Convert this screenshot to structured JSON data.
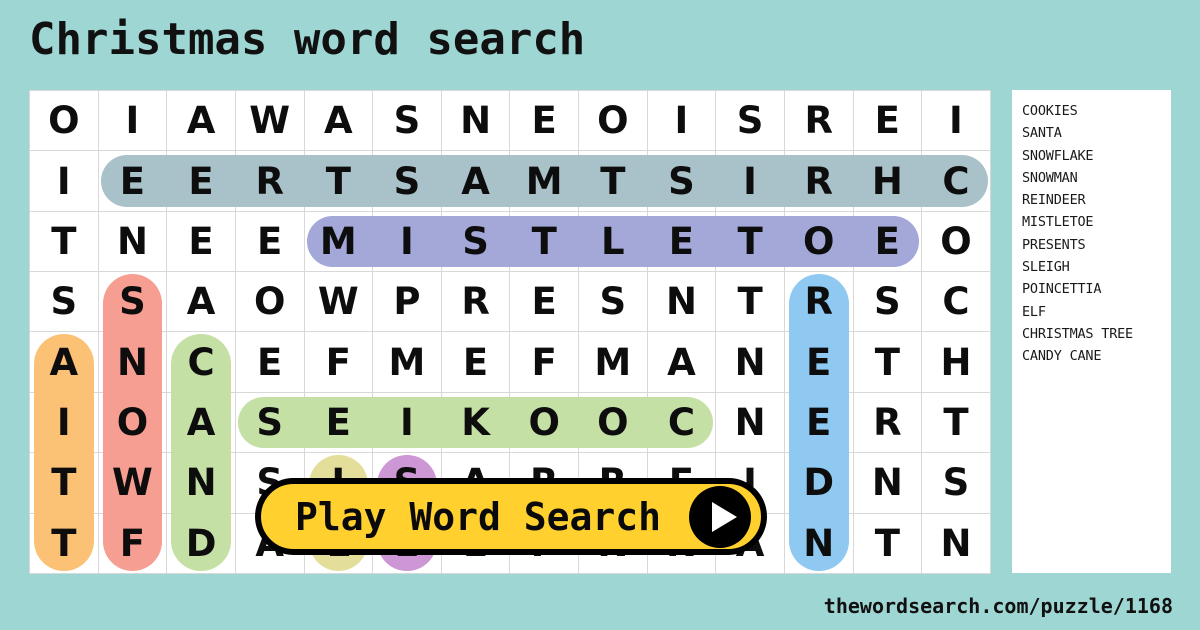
{
  "page": {
    "title": "Christmas word search",
    "background_color": "#9ed6d3",
    "footer_url": "thewordsearch.com/puzzle/1168"
  },
  "play_button": {
    "label": "Play Word Search",
    "icon": "play-triangle-icon",
    "background_color": "#ffd02e",
    "border_color": "#000000"
  },
  "word_list": {
    "words": [
      "COOKIES",
      "SANTA",
      "SNOWFLAKE",
      "SNOWMAN",
      "REINDEER",
      "MISTLETOE",
      "PRESENTS",
      "SLEIGH",
      "POINCETTIA",
      "ELF",
      "CHRISTMAS TREE",
      "CANDY CANE"
    ]
  },
  "grid": {
    "rows": 8,
    "cols": 14,
    "letters": [
      [
        "O",
        "I",
        "A",
        "W",
        "A",
        "S",
        "N",
        "E",
        "O",
        "I",
        "S",
        "R",
        "E",
        "I"
      ],
      [
        "I",
        "E",
        "E",
        "R",
        "T",
        "S",
        "A",
        "M",
        "T",
        "S",
        "I",
        "R",
        "H",
        "C"
      ],
      [
        "T",
        "N",
        "E",
        "E",
        "M",
        "I",
        "S",
        "T",
        "L",
        "E",
        "T",
        "O",
        "E",
        "O"
      ],
      [
        "S",
        "S",
        "A",
        "O",
        "W",
        "P",
        "R",
        "E",
        "S",
        "N",
        "T",
        "R",
        "S",
        "C"
      ],
      [
        "A",
        "N",
        "C",
        "E",
        "F",
        "M",
        "E",
        "F",
        "M",
        "A",
        "N",
        "E",
        "T",
        "H"
      ],
      [
        "I",
        "O",
        "A",
        "S",
        "E",
        "I",
        "K",
        "O",
        "O",
        "C",
        "N",
        "E",
        "R",
        "T"
      ],
      [
        "T",
        "W",
        "N",
        "S",
        "I",
        "S",
        "A",
        "R",
        "R",
        "E",
        "I",
        "D",
        "N",
        "S"
      ],
      [
        "T",
        "F",
        "D",
        "A",
        "L",
        "E",
        "E",
        "P",
        "N",
        "N",
        "A",
        "N",
        "T",
        "N"
      ]
    ],
    "highlights": [
      {
        "word": "CHRISTMAS",
        "color": "#a9c1c8",
        "orientation": "horizontal",
        "cells": [
          [
            1,
            1
          ],
          [
            1,
            2
          ],
          [
            1,
            3
          ],
          [
            1,
            4
          ],
          [
            1,
            5
          ],
          [
            1,
            6
          ],
          [
            1,
            7
          ],
          [
            1,
            8
          ],
          [
            1,
            9
          ],
          [
            1,
            10
          ],
          [
            1,
            11
          ],
          [
            1,
            12
          ],
          [
            1,
            13
          ]
        ]
      },
      {
        "word": "MISTLETOE",
        "color": "#a3a8d8",
        "orientation": "horizontal",
        "cells": [
          [
            2,
            4
          ],
          [
            2,
            5
          ],
          [
            2,
            6
          ],
          [
            2,
            7
          ],
          [
            2,
            8
          ],
          [
            2,
            9
          ],
          [
            2,
            10
          ],
          [
            2,
            11
          ],
          [
            2,
            12
          ]
        ]
      },
      {
        "word": "COOKIES",
        "color": "#c5e0a5",
        "orientation": "horizontal",
        "cells": [
          [
            5,
            3
          ],
          [
            5,
            4
          ],
          [
            5,
            5
          ],
          [
            5,
            6
          ],
          [
            5,
            7
          ],
          [
            5,
            8
          ],
          [
            5,
            9
          ]
        ]
      },
      {
        "word": "SNOWMAN",
        "color": "#f79e92",
        "orientation": "vertical",
        "cells": [
          [
            3,
            1
          ],
          [
            4,
            1
          ],
          [
            5,
            1
          ],
          [
            6,
            1
          ],
          [
            7,
            1
          ]
        ]
      },
      {
        "word": "SANTA",
        "color": "#fbc276",
        "orientation": "vertical",
        "cells": [
          [
            4,
            0
          ],
          [
            5,
            0
          ],
          [
            6,
            0
          ],
          [
            7,
            0
          ]
        ]
      },
      {
        "word": "CANDY",
        "color": "#c5e0a5",
        "orientation": "vertical",
        "cells": [
          [
            4,
            2
          ],
          [
            5,
            2
          ],
          [
            6,
            2
          ],
          [
            7,
            2
          ]
        ]
      },
      {
        "word": "REINDEER",
        "color": "#8fc9f2",
        "orientation": "vertical",
        "cells": [
          [
            3,
            11
          ],
          [
            4,
            11
          ],
          [
            5,
            11
          ],
          [
            6,
            11
          ],
          [
            7,
            11
          ]
        ]
      },
      {
        "word": "SLEIGH",
        "color": "#e3de9a",
        "orientation": "vertical",
        "cells": [
          [
            6,
            4
          ],
          [
            7,
            4
          ]
        ]
      },
      {
        "word": "ELF",
        "color": "#cd96d4",
        "orientation": "vertical",
        "cells": [
          [
            6,
            5
          ],
          [
            7,
            5
          ]
        ]
      }
    ]
  }
}
